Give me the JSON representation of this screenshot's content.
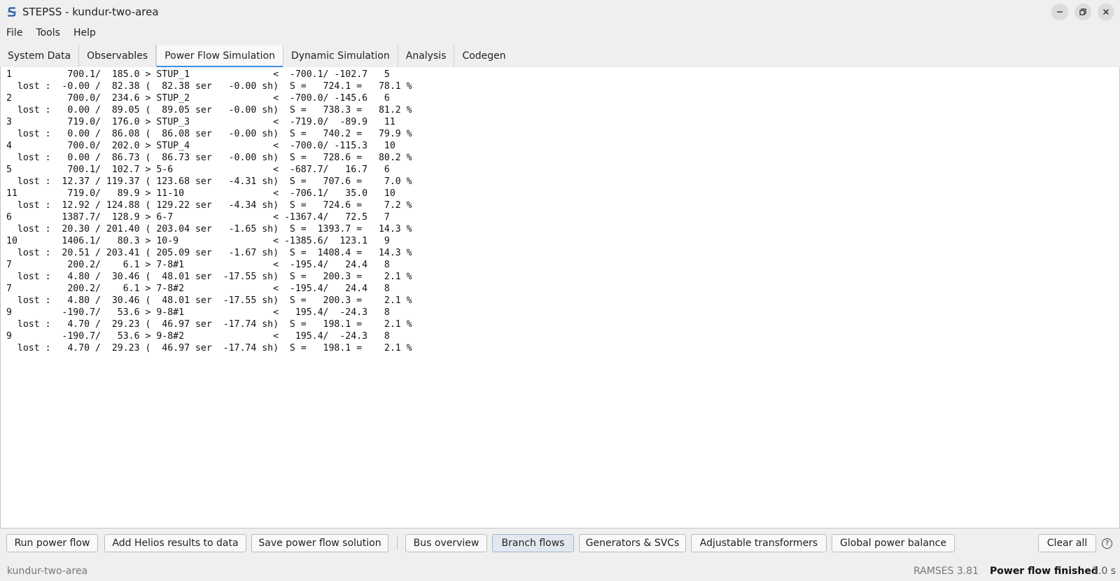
{
  "window": {
    "title": "STEPSS - kundur-two-area"
  },
  "menu": [
    "File",
    "Tools",
    "Help"
  ],
  "tabs": [
    {
      "label": "System Data",
      "active": false
    },
    {
      "label": "Observables",
      "active": false
    },
    {
      "label": "Power Flow Simulation",
      "active": true
    },
    {
      "label": "Dynamic Simulation",
      "active": false
    },
    {
      "label": "Analysis",
      "active": false
    },
    {
      "label": "Codegen",
      "active": false
    }
  ],
  "output_lines": [
    "1          700.1/  185.0 > STUP_1               <  -700.1/ -102.7   5",
    "  lost :  -0.00 /  82.38 (  82.38 ser   -0.00 sh)  S =   724.1 =   78.1 %",
    "2          700.0/  234.6 > STUP_2               <  -700.0/ -145.6   6",
    "  lost :   0.00 /  89.05 (  89.05 ser   -0.00 sh)  S =   738.3 =   81.2 %",
    "3          719.0/  176.0 > STUP_3               <  -719.0/  -89.9   11",
    "  lost :   0.00 /  86.08 (  86.08 ser   -0.00 sh)  S =   740.2 =   79.9 %",
    "4          700.0/  202.0 > STUP_4               <  -700.0/ -115.3   10",
    "  lost :   0.00 /  86.73 (  86.73 ser   -0.00 sh)  S =   728.6 =   80.2 %",
    "5          700.1/  102.7 > 5-6                  <  -687.7/   16.7   6",
    "  lost :  12.37 / 119.37 ( 123.68 ser   -4.31 sh)  S =   707.6 =    7.0 %",
    "11         719.0/   89.9 > 11-10                <  -706.1/   35.0   10",
    "  lost :  12.92 / 124.88 ( 129.22 ser   -4.34 sh)  S =   724.6 =    7.2 %",
    "6         1387.7/  128.9 > 6-7                  < -1367.4/   72.5   7",
    "  lost :  20.30 / 201.40 ( 203.04 ser   -1.65 sh)  S =  1393.7 =   14.3 %",
    "10        1406.1/   80.3 > 10-9                 < -1385.6/  123.1   9",
    "  lost :  20.51 / 203.41 ( 205.09 ser   -1.67 sh)  S =  1408.4 =   14.3 %",
    "7          200.2/    6.1 > 7-8#1                <  -195.4/   24.4   8",
    "  lost :   4.80 /  30.46 (  48.01 ser  -17.55 sh)  S =   200.3 =    2.1 %",
    "7          200.2/    6.1 > 7-8#2                <  -195.4/   24.4   8",
    "  lost :   4.80 /  30.46 (  48.01 ser  -17.55 sh)  S =   200.3 =    2.1 %",
    "9         -190.7/   53.6 > 9-8#1                <   195.4/  -24.3   8",
    "  lost :   4.70 /  29.23 (  46.97 ser  -17.74 sh)  S =   198.1 =    2.1 %",
    "9         -190.7/   53.6 > 9-8#2                <   195.4/  -24.3   8",
    "  lost :   4.70 /  29.23 (  46.97 ser  -17.74 sh)  S =   198.1 =    2.1 %"
  ],
  "toolbar": {
    "run_power_flow": "Run power flow",
    "add_helios": "Add Helios results to data",
    "save_solution": "Save power flow solution",
    "bus_overview": "Bus overview",
    "branch_flows": "Branch flows",
    "generators_svcs": "Generators & SVCs",
    "adjustable_transformers": "Adjustable transformers",
    "global_power_balance": "Global power balance",
    "clear_all": "Clear all",
    "help_glyph": "?"
  },
  "status": {
    "project": "kundur-two-area",
    "version": "RAMSES 3.81",
    "message": "Power flow finished",
    "elapsed": "3.0 s"
  },
  "colors": {
    "accent": "#3d8ee5",
    "logo": "#2a5d9f"
  }
}
